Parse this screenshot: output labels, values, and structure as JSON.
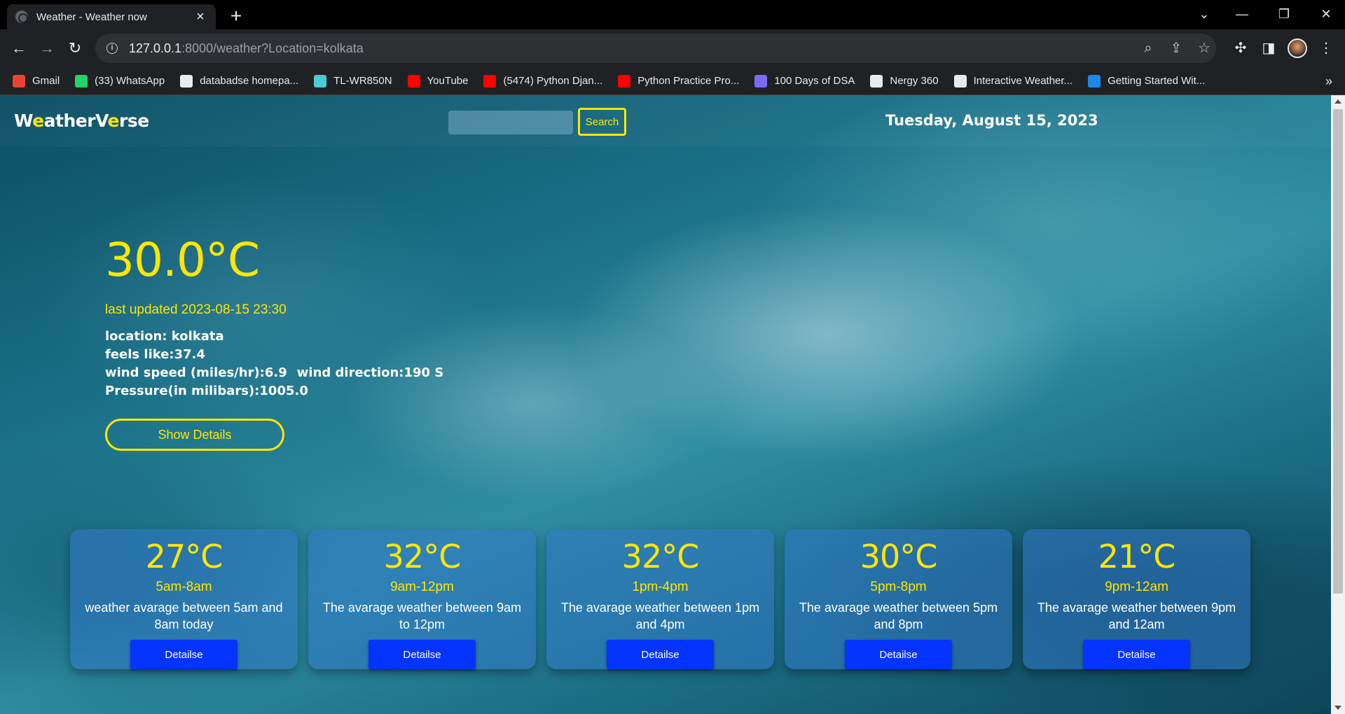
{
  "browser": {
    "tab_title": "Weather - Weather now",
    "url_host": "127.0.0.1",
    "url_rest": ":8000/weather?Location=kolkata",
    "bookmarks": [
      {
        "label": "Gmail",
        "color": "#ea4335"
      },
      {
        "label": "(33) WhatsApp",
        "color": "#25d366"
      },
      {
        "label": "databadse homepa...",
        "color": "#e8eaed"
      },
      {
        "label": "TL-WR850N",
        "color": "#4acbd6"
      },
      {
        "label": "YouTube",
        "color": "#ff0000"
      },
      {
        "label": "(5474) Python Djan...",
        "color": "#ff0000"
      },
      {
        "label": "Python Practice Pro...",
        "color": "#ff0000"
      },
      {
        "label": "100 Days of DSA",
        "color": "#7b6cf6"
      },
      {
        "label": "Nergy 360",
        "color": "#e8eaed"
      },
      {
        "label": "Interactive Weather...",
        "color": "#e8eaed"
      },
      {
        "label": "Getting Started Wit...",
        "color": "#1e88e5"
      }
    ]
  },
  "header": {
    "brand_parts": [
      "W",
      "e",
      "ather",
      "V",
      "e",
      "rse"
    ],
    "search_placeholder": "",
    "search_label": "Search",
    "date": "Tuesday, August 15, 2023"
  },
  "current": {
    "temperature": "30.0°C",
    "last_updated": "last updated 2023-08-15 23:30",
    "location": "location: kolkata",
    "feels_like": "feels like:37.4",
    "wind_speed": "wind speed (miles/hr):6.9",
    "wind_direction": "wind direction:190 S",
    "pressure": "Pressure(in milibars):1005.0",
    "details_label": "Show Details"
  },
  "forecast": [
    {
      "temp": "27°C",
      "range": "5am-8am",
      "desc": "weather avarage between 5am and 8am today",
      "button": "Detailse"
    },
    {
      "temp": "32°C",
      "range": "9am-12pm",
      "desc": "The avarage weather between 9am to 12pm",
      "button": "Detailse"
    },
    {
      "temp": "32°C",
      "range": "1pm-4pm",
      "desc": "The avarage weather between 1pm and 4pm",
      "button": "Detailse"
    },
    {
      "temp": "30°C",
      "range": "5pm-8pm",
      "desc": "The avarage weather between 5pm and 8pm",
      "button": "Detailse"
    },
    {
      "temp": "21°C",
      "range": "9pm-12am",
      "desc": "The avarage weather between 9pm and 12am",
      "button": "Detailse"
    }
  ],
  "colors": {
    "accent": "#ffe600",
    "button": "#0533ff"
  }
}
